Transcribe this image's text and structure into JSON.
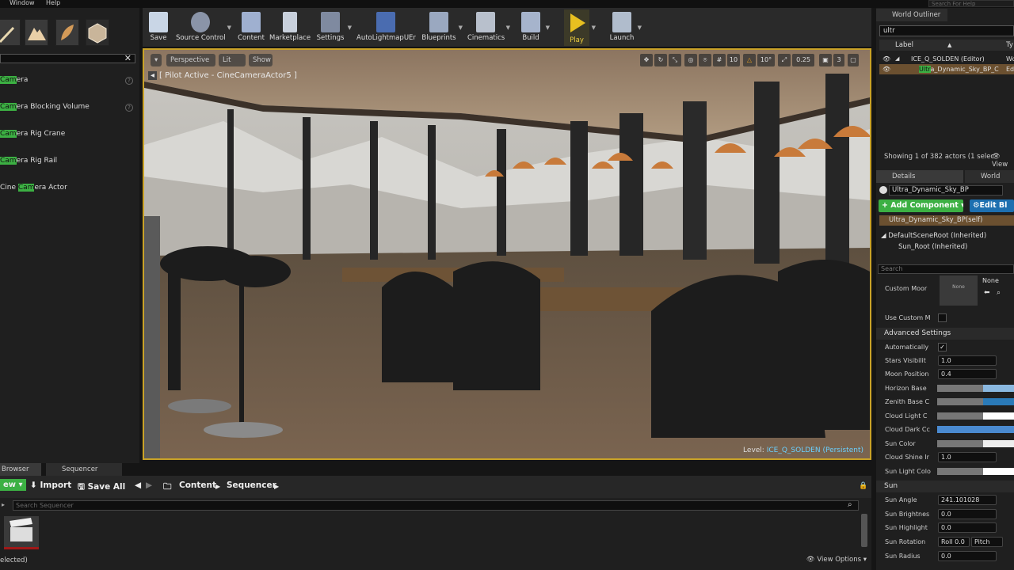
{
  "menu": {
    "window": "Window",
    "help": "Help",
    "search_help": "Search For Help"
  },
  "place_items": [
    {
      "prefix": "",
      "highlight": "Cam",
      "rest": "era"
    },
    {
      "prefix": "",
      "highlight": "Cam",
      "rest": "era Blocking Volume"
    },
    {
      "prefix": "",
      "highlight": "Cam",
      "rest": "era Rig Crane"
    },
    {
      "prefix": "",
      "highlight": "Cam",
      "rest": "era Rig Rail"
    },
    {
      "prefix": "Cine ",
      "highlight": "Cam",
      "rest": "era Actor"
    }
  ],
  "toolbar": {
    "save": "Save",
    "source_control": "Source Control",
    "content": "Content",
    "marketplace": "Marketplace",
    "settings": "Settings",
    "autolightmap": "AutoLightmapUEr",
    "blueprints": "Blueprints",
    "cinematics": "Cinematics",
    "build": "Build",
    "play": "Play",
    "launch": "Launch"
  },
  "viewport": {
    "perspective": "Perspective",
    "lit": "Lit",
    "show": "Show",
    "pilot": "[ Pilot Active - CineCameraActor5 ]",
    "grid_snap": "10",
    "rot_snap": "10°",
    "scale_snap": "0.25",
    "cam_speed": "3",
    "level_label": "Level:",
    "level_name": "ICE_Q_SOLDEN (Persistent)"
  },
  "outliner": {
    "title": "World Outliner",
    "search": "ultr",
    "col_label": "Label",
    "col_type": "Ty",
    "row1": "ICE_Q_SOLDEN (Editor)",
    "row1_type": "Wo",
    "row2_hl": "Ultr",
    "row2_rest": "a_Dynamic_Sky_BP_C",
    "row2_type": "Ed",
    "count": "Showing 1 of 382 actors (1 selec",
    "view": "View"
  },
  "details": {
    "tab": "Details",
    "world_tab": "World Setti",
    "name": "Ultra_Dynamic_Sky_BP",
    "add_component": "+ Add Component ▾",
    "edit_bp": "Edit Bl",
    "self": "Ultra_Dynamic_Sky_BP(self)",
    "root": "DefaultSceneRoot (Inherited)",
    "sun_root": "Sun_Root (Inherited)",
    "search": "Search",
    "custom_moon": "Custom Moor",
    "none_thumb": "None",
    "none_label": "None",
    "use_custom": "Use Custom M",
    "advanced": "Advanced Settings",
    "automatically": "Automatically",
    "stars": "Stars Visibilit",
    "stars_val": "1.0",
    "moon_pos": "Moon Position",
    "moon_pos_val": "0.4",
    "horizon": "Horizon Base",
    "zenith": "Zenith Base C",
    "cloud_light": "Cloud Light C",
    "cloud_dark": "Cloud Dark Cc",
    "sun_color": "Sun Color",
    "cloud_shine": "Cloud Shine Ir",
    "cloud_shine_val": "1.0",
    "sun_light_color": "Sun Light Colo",
    "sun_section": "Sun",
    "sun_angle": "Sun Angle",
    "sun_angle_val": "241.101028",
    "sun_brightness": "Sun Brightnes",
    "sun_brightness_val": "0.0",
    "sun_highlight": "Sun Highlight",
    "sun_highlight_val": "0.0",
    "sun_rotation": "Sun Rotation",
    "roll": "Roll",
    "roll_val": "0.0",
    "pitch": "Pitch",
    "sun_radius": "Sun Radius",
    "sun_radius_val": "0.0"
  },
  "content_browser": {
    "tab_browser": "Browser",
    "tab_sequencer": "Sequencer",
    "add_new": "ew ▾",
    "import": "Import",
    "save_all": "Save All",
    "crumb1": "Content",
    "crumb2": "Sequencer",
    "search": "Search Sequencer",
    "status": "elected)",
    "view_options": "View Options ▾"
  },
  "colors": {
    "accent": "#3cb043",
    "viewport_border": "#c9a227",
    "edit_bp": "#1d6fb0"
  }
}
